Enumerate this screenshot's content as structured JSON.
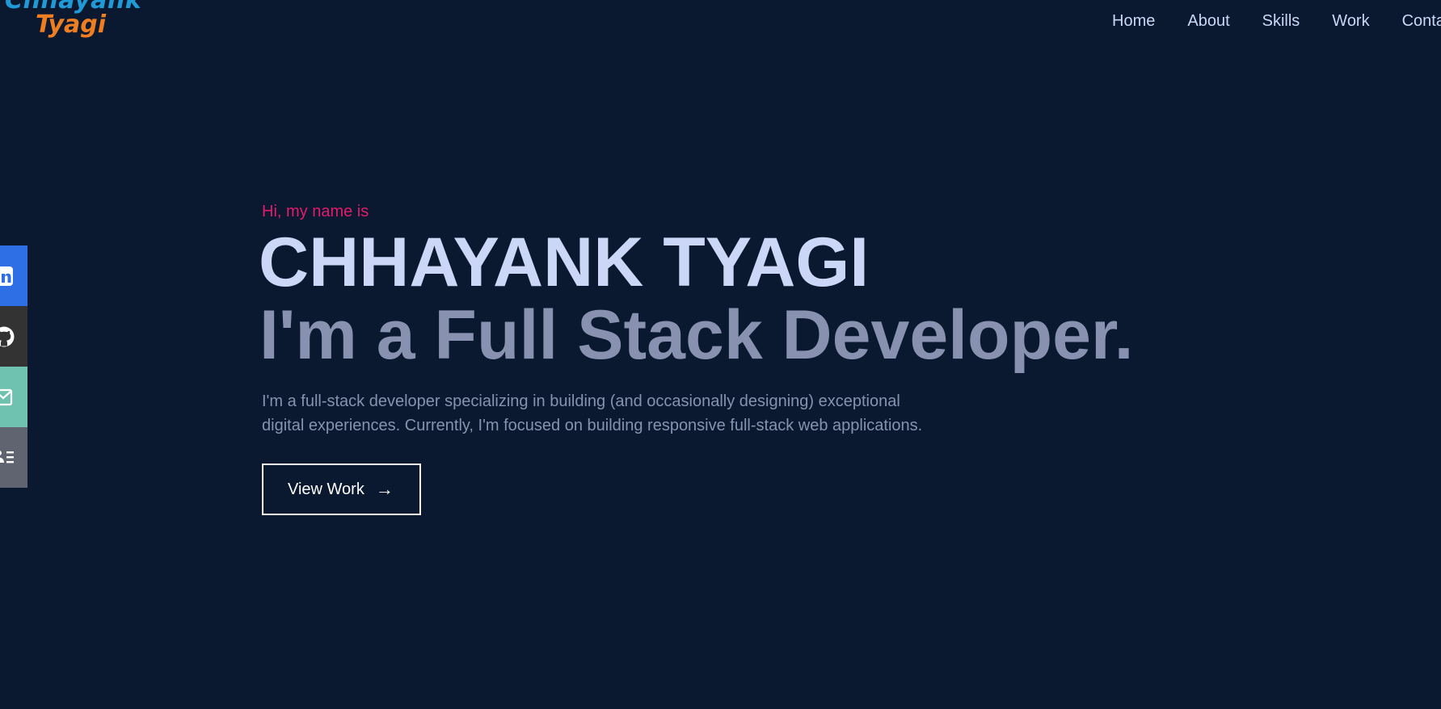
{
  "logo": {
    "line1": "Chhayank",
    "line2": "Tyagi"
  },
  "nav": {
    "items": [
      "Home",
      "About",
      "Skills",
      "Work",
      "Contact"
    ]
  },
  "social": {
    "icons": [
      "linkedin-icon",
      "github-icon",
      "email-icon",
      "resume-icon"
    ],
    "colors": {
      "linkedin": "#2f6fe6",
      "github": "#333333",
      "email": "#6fc2b0",
      "resume": "#5f6470"
    }
  },
  "hero": {
    "greeting": "Hi, my name is",
    "name": "CHHAYANK TYAGI",
    "tagline": "I'm a Full Stack Developer.",
    "description_line1": "I'm a full-stack developer specializing in building (and occasionally designing) exceptional",
    "description_line2": "digital experiences. Currently, I'm focused on building responsive full-stack web applications.",
    "button_label": "View Work",
    "button_arrow": "→"
  },
  "colors": {
    "background": "#0a192f",
    "accent": "#e31b6d",
    "heading": "#ccd6f6",
    "muted": "#8892b0"
  }
}
